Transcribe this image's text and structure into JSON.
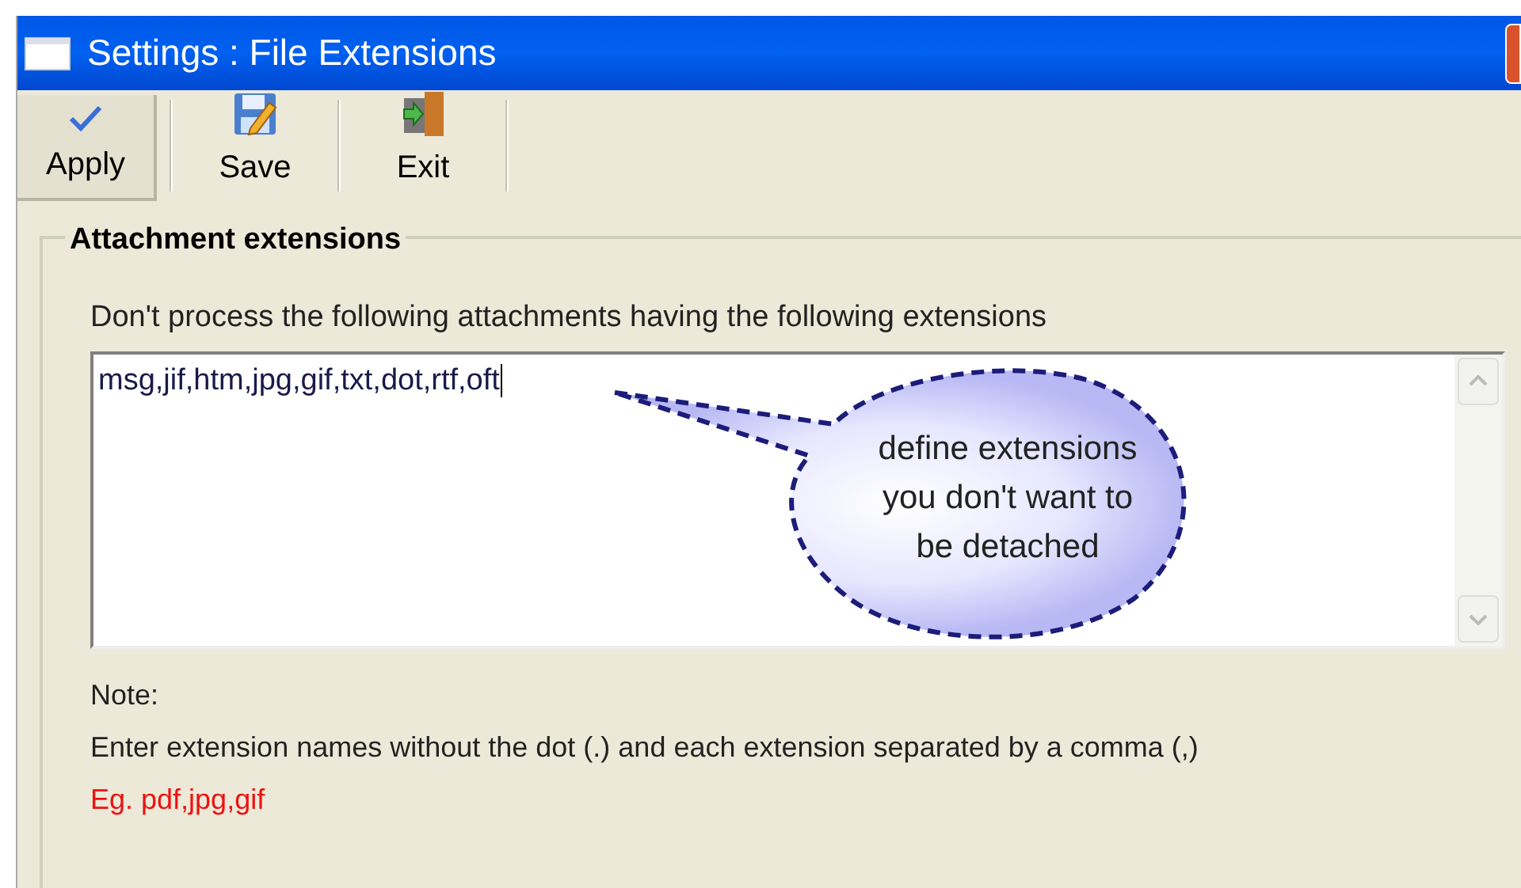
{
  "window": {
    "title": "Settings : File Extensions"
  },
  "toolbar": [
    {
      "label": "Apply",
      "kind": "apply",
      "selected": true
    },
    {
      "label": "Save",
      "kind": "save",
      "selected": false
    },
    {
      "label": "Exit",
      "kind": "exit",
      "selected": false
    }
  ],
  "group": {
    "title": "Attachment extensions",
    "instruction": "Don't process the following attachments having the following extensions",
    "extensions_field": {
      "value": "msg,jif,htm,jpg,gif,txt,dot,rtf,oft"
    },
    "callout": "define extensions you don't want to be detached",
    "note_label": "Note:",
    "note_text": "Enter extension names without the dot (.)  and each extension separated by a comma (,)",
    "example": "Eg. pdf,jpg,gif"
  }
}
